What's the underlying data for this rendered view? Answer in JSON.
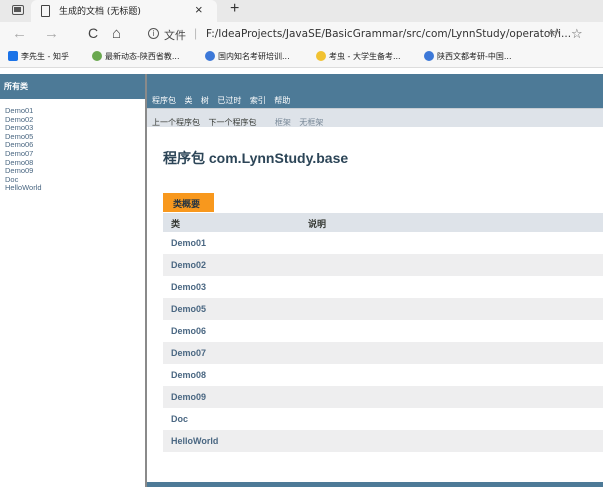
{
  "browser": {
    "tab_title": "生成的文档 (无标题)",
    "tab_close": "×",
    "new_tab": "+",
    "nav": {
      "back": "←",
      "forward": "→",
      "reload": "C",
      "home": "⌂"
    },
    "url_label": "文件",
    "url": "F:/IdeaProjects/JavaSE/BasicGrammar/src/com/LynnStudy/operator/i...",
    "reader": "Aᴬ",
    "favorite": "☆",
    "bookmarks": [
      {
        "label": "李先生 - 知乎",
        "color": "#1b73e8"
      },
      {
        "label": "最新动态-陕西省教...",
        "color": "#6aa84f"
      },
      {
        "label": "国内知名考研培训...",
        "color": "#3c78d8"
      },
      {
        "label": "考虫 - 大学生备考...",
        "color": "#f1c232"
      },
      {
        "label": "陕西文都考研-中国...",
        "color": "#3c78d8"
      }
    ]
  },
  "left_frame": {
    "header": "所有类",
    "classes": [
      "Demo01",
      "Demo02",
      "Demo03",
      "Demo05",
      "Demo06",
      "Demo07",
      "Demo08",
      "Demo09",
      "Doc",
      "HelloWorld"
    ]
  },
  "right_frame": {
    "topnav": [
      "程序包",
      "类",
      "树",
      "已过时",
      "索引",
      "帮助"
    ],
    "subnav": {
      "prev_package": "上一个程序包",
      "next_package": "下一个程序包",
      "frames": "框架",
      "no_frames": "无框架"
    },
    "package_title": "程序包 com.LynnStudy.base",
    "summary_caption": "类概要",
    "table_headers": {
      "class": "类",
      "description": "说明"
    },
    "classes": [
      "Demo01",
      "Demo02",
      "Demo03",
      "Demo05",
      "Demo06",
      "Demo07",
      "Demo08",
      "Demo09",
      "Doc",
      "HelloWorld"
    ]
  },
  "colors": {
    "header_blue": "#4d7a97",
    "caption_orange": "#f8981d",
    "link_blue": "#4a6782",
    "subnav_gray": "#dee3e9"
  }
}
